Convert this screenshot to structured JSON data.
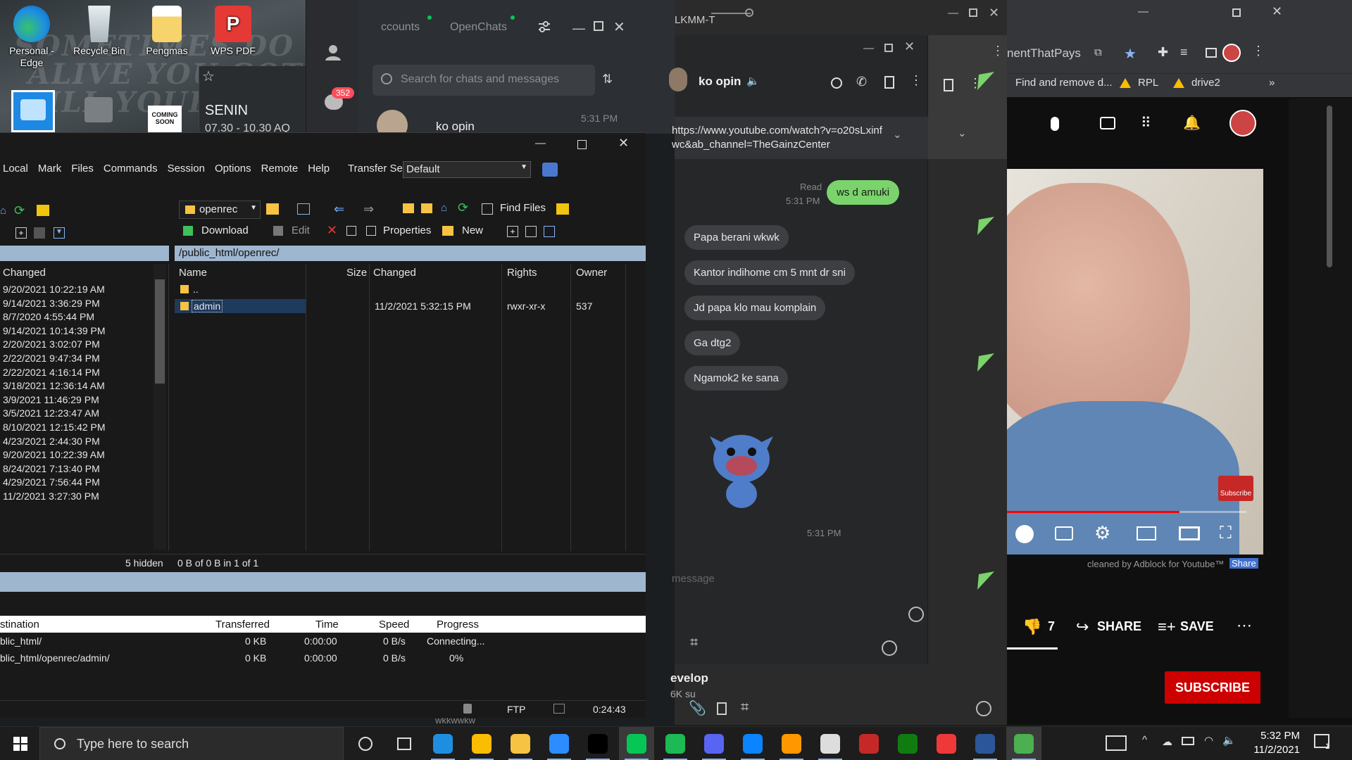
{
  "desktop": {
    "icons": [
      {
        "label": "Personal -\nEdge",
        "icon": "edge-icon",
        "color": "#1e8fe0"
      },
      {
        "label": "Recycle Bin",
        "icon": "recycle-bin-icon",
        "color": "#cfd8dc"
      },
      {
        "label": "Pengmas",
        "icon": "folder-icon",
        "color": "#f6d36b"
      },
      {
        "label": "WPS PDF",
        "icon": "wps-pdf-icon",
        "color": "#e53935"
      }
    ],
    "wallpaper_lines": [
      "SOMETIMES DO ST",
      "ALIVE YOU GOT",
      "KILL YOUR MIND"
    ],
    "notif_card": {
      "day": "SENIN",
      "time": "07.30 - 10.30 AQ"
    },
    "coming_soon": "COMING SOON"
  },
  "line_chat": {
    "tabs": [
      "ccounts",
      "OpenChats"
    ],
    "search_placeholder": "Search for chats and messages",
    "unread_badge": "352",
    "first_chat": {
      "name": "ko opin",
      "time": "5:31 PM"
    }
  },
  "chat2": {
    "title_fragment": "LKMM-T",
    "contact_name": "ko opin",
    "link_text": "https://www.youtube.com/watch?v=o20sLxinfwc&ab_channel=TheGainzCenter",
    "read_label": "Read",
    "sent_time": "5:31 PM",
    "sent_message": "ws d amuki",
    "received": [
      "Papa berani wkwk",
      "Kantor indihome cm 5 mnt dr sni",
      "Jd papa klo mau komplain",
      "Ga dtg2",
      "Ngamok2 ke sana"
    ],
    "sticker_time": "5:31 PM",
    "input_placeholder": "message",
    "side_preview": {
      "title": "evelop",
      "sub": "6K su"
    },
    "bottom_preview": "wkkwwkw"
  },
  "winscp": {
    "menu": [
      "Local",
      "Mark",
      "Files",
      "Commands",
      "Session",
      "Options",
      "Remote",
      "Help"
    ],
    "transfer_settings_label": "Transfer Settings",
    "transfer_settings_value": "Default",
    "remote_dir": "openrec",
    "remote_toolbar": {
      "find_files": "Find Files",
      "download": "Download",
      "edit": "Edit",
      "properties": "Properties",
      "new": "New"
    },
    "remote_path": "/public_html/openrec/",
    "local_header": "Changed",
    "local_dates": [
      "9/20/2021  10:22:19 AM",
      "9/14/2021  3:36:29 PM",
      "8/7/2020  4:55:44 PM",
      "9/14/2021  10:14:39 PM",
      "2/20/2021  3:02:07 PM",
      "2/22/2021  9:47:34 PM",
      "2/22/2021  4:16:14 PM",
      "3/18/2021  12:36:14 AM",
      "3/9/2021  11:46:29 PM",
      "3/5/2021  12:23:47 AM",
      "8/10/2021  12:15:42 PM",
      "4/23/2021  2:44:30 PM",
      "9/20/2021  10:22:39 AM",
      "8/24/2021  7:13:40 PM",
      "4/29/2021  7:56:44 PM",
      "11/2/2021  3:27:30 PM"
    ],
    "remote_columns": [
      "Name",
      "Size",
      "Changed",
      "Rights",
      "Owner"
    ],
    "remote_rows": [
      {
        "name": "..",
        "size": "",
        "changed": "",
        "rights": "",
        "owner": ""
      },
      {
        "name": "admin",
        "size": "",
        "changed": "11/2/2021 5:32:15 PM",
        "rights": "rwxr-xr-x",
        "owner": "537"
      }
    ],
    "local_status": "5 hidden",
    "remote_status": "0 B of 0 B in 1 of 1",
    "queue_columns": [
      "stination",
      "Transferred",
      "Time",
      "Speed",
      "Progress"
    ],
    "queue_rows": [
      {
        "dest": "blic_html/",
        "transferred": "0 KB",
        "time": "0:00:00",
        "speed": "0 B/s",
        "progress": "Connecting..."
      },
      {
        "dest": "blic_html/openrec/admin/",
        "transferred": "0 KB",
        "time": "0:00:00",
        "speed": "0 B/s",
        "progress": "0%"
      }
    ],
    "status_protocol": "FTP",
    "status_time": "0:24:43"
  },
  "youtube": {
    "tab_title": "nentThatPays",
    "bookmarks": [
      "Find and remove d...",
      "RPL",
      "drive2"
    ],
    "dislike_count": "7",
    "share_label": "SHARE",
    "save_label": "SAVE",
    "subscribe_label": "SUBSCRIBE",
    "adblock_text": "cleaned by Adblock for Youtube™",
    "adblock_share": "Share",
    "watermark_label": "Subscribe",
    "progress_fraction": 0.72
  },
  "taskbar": {
    "search_placeholder": "Type here to search",
    "time": "5:32 PM",
    "date": "11/2/2021",
    "apps": [
      "cortana-icon",
      "task-view-icon",
      "edge-icon",
      "chrome-icon",
      "file-explorer-icon",
      "zoom-icon",
      "intellij-icon",
      "line-icon",
      "spotify-icon",
      "discord-icon",
      "vscode-icon",
      "sublime-icon",
      "gamepad-icon",
      "rog-icon",
      "xbox-icon",
      "vivaldi-icon",
      "word-icon",
      "winscp-icon"
    ],
    "notification_count": "1"
  }
}
